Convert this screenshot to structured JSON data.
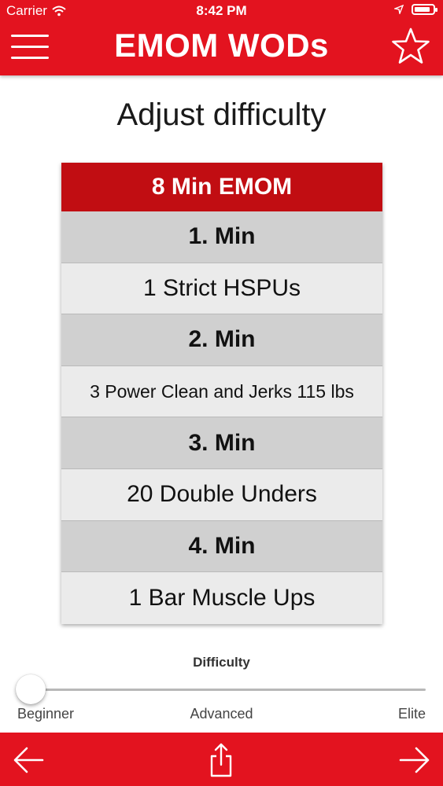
{
  "status_bar": {
    "carrier": "Carrier",
    "time": "8:42 PM",
    "battery_level": 0.85
  },
  "nav": {
    "title": "EMOM WODs",
    "menu_icon": "hamburger-menu-icon",
    "favorite_icon": "star-outline-icon"
  },
  "page": {
    "heading": "Adjust difficulty"
  },
  "workout": {
    "title": "8 Min EMOM",
    "rows": [
      {
        "label": "1. Min",
        "kind": "minute"
      },
      {
        "label": "1 Strict HSPUs",
        "kind": "exercise"
      },
      {
        "label": "2. Min",
        "kind": "minute"
      },
      {
        "label": "3 Power Clean and Jerks 115 lbs",
        "kind": "exercise"
      },
      {
        "label": "3. Min",
        "kind": "minute"
      },
      {
        "label": "20 Double Unders",
        "kind": "exercise"
      },
      {
        "label": "4. Min",
        "kind": "minute"
      },
      {
        "label": "1 Bar Muscle Ups",
        "kind": "exercise"
      }
    ]
  },
  "difficulty": {
    "label": "Difficulty",
    "value": 0,
    "levels": [
      "Beginner",
      "Advanced",
      "Elite"
    ]
  },
  "bottom_bar": {
    "back_icon": "arrow-left-icon",
    "share_icon": "share-icon",
    "forward_icon": "arrow-right-icon"
  },
  "colors": {
    "accent": "#e3131f",
    "header_row": "#c10d12",
    "minute_row": "#d0d0d0",
    "exercise_row": "#ebebeb"
  }
}
